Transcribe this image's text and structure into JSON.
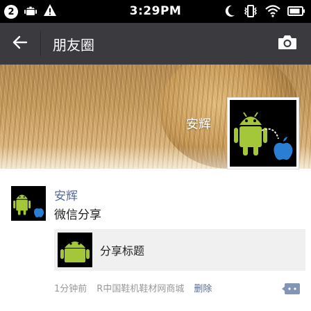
{
  "status_bar": {
    "notification_badge": "2",
    "time": "3:29PM"
  },
  "header": {
    "title": "朋友圈"
  },
  "cover": {
    "username": "安辉"
  },
  "post": {
    "author": "安辉",
    "text": "微信分享",
    "share": {
      "title": "分享标题"
    },
    "time_ago": "1分钟前",
    "source": "R中国鞋机鞋材网商城",
    "delete_label": "删除"
  },
  "icons": {
    "back": "arrow-left-icon",
    "camera": "camera-icon",
    "comment": "comment-icon",
    "android": "android-icon",
    "apple": "apple-icon"
  },
  "colors": {
    "status_bar": "#000000",
    "action_bar": "#3a3a3f",
    "link": "#576b95",
    "share_card_bg": "#f0f0f0",
    "meta_text": "#999999",
    "android_green": "#a4c639",
    "apple_blue": "#2a7fd4"
  }
}
